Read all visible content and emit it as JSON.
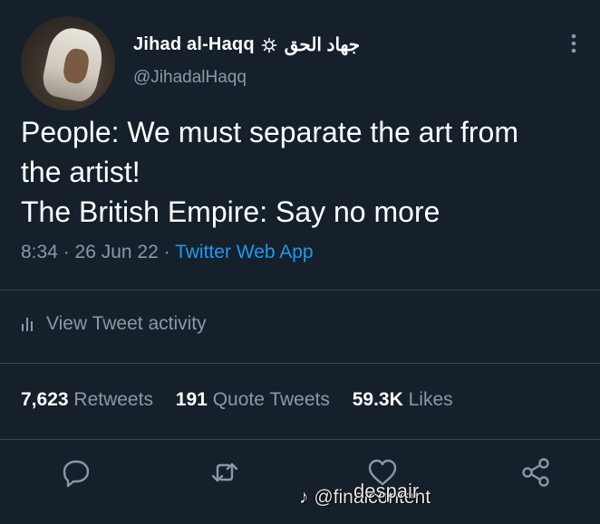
{
  "profile": {
    "display_name": "Jihad al-Haqq",
    "arabic_name": "جهاد الحق",
    "handle": "@JihadalHaqq"
  },
  "tweet": {
    "lines": [
      "People: We must separate the art from",
      "the artist!",
      "The British Empire: Say no more"
    ],
    "time": "8:34",
    "date": "26 Jun 22",
    "source": "Twitter Web App"
  },
  "activity_label": "View Tweet activity",
  "stats": {
    "retweets_count": "7,623",
    "retweets_label": "Retweets",
    "quotes_count": "191",
    "quotes_label": "Quote Tweets",
    "likes_count": "59.3K",
    "likes_label": "Likes"
  },
  "watermark": {
    "text": "@finalcontent",
    "handle": "despair"
  },
  "colors": {
    "background": "#15202b",
    "text": "#ffffff",
    "secondary": "#8b98a5",
    "link": "#1d9bf0",
    "divider": "#38444d"
  },
  "icons": [
    "verified-badge-icon",
    "more-vertical-icon",
    "bar-chart-icon",
    "reply-icon",
    "retweet-icon",
    "like-icon",
    "share-icon",
    "tiktok-icon"
  ]
}
